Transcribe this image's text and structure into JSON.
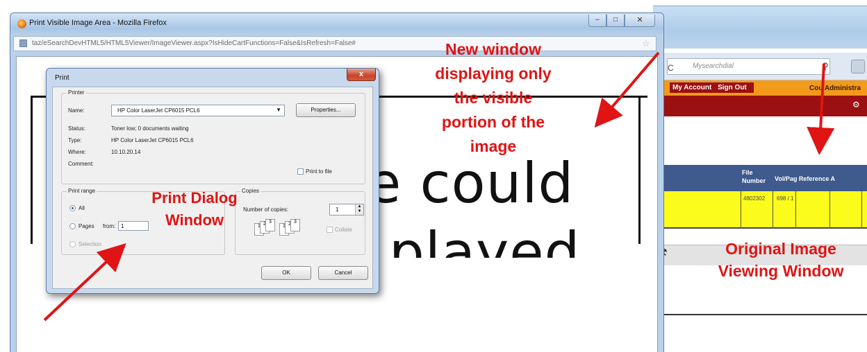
{
  "colors": {
    "annotation_red": "#e01414",
    "highlight_yellow": "#fcfc1c",
    "brand_dark_red": "#9b1010",
    "brand_orange": "#f39a1b",
    "table_header_blue": "#3f5a8c"
  },
  "firefox_window": {
    "title": "Print Visible Image Area - Mozilla Firefox",
    "url": "taz/eSearchDevHTML5/HTML5Viewer/ImageViewer.aspx?IsHideCartFunctions=False&IsRefresh=False#",
    "icons": [
      "firefox-logo-icon",
      "minimize-icon",
      "maximize-icon",
      "close-icon",
      "star-icon"
    ],
    "visible_image_text": [
      "e could",
      "played"
    ]
  },
  "print_dialog": {
    "title": "Print",
    "close_label": "x",
    "printer_group_label": "Printer",
    "name_label": "Name:",
    "name_value": "HP Color LaserJet CP6015 PCL6",
    "properties_button": "Properties...",
    "status_label": "Status:",
    "status_value": "Toner low; 0 documents waiting",
    "type_label": "Type:",
    "type_value": "HP Color LaserJet CP6015 PCL6",
    "where_label": "Where:",
    "where_value": "10.10.20.14",
    "comment_label": "Comment:",
    "print_to_file_label": "Print to file",
    "print_range_label": "Print range",
    "all_label": "All",
    "pages_label": "Pages",
    "from_label": "from:",
    "from_value": "1",
    "selection_label": "Selection",
    "copies_label": "Copies",
    "number_of_copies_label": "Number of copies:",
    "number_of_copies_value": "1",
    "collate_label": "Collate",
    "ok_button": "OK",
    "cancel_button": "Cancel"
  },
  "background_window": {
    "search_placeholder": "Mysearchdial",
    "menu": [
      "My Account",
      "Sign Out"
    ],
    "court_label": "Cou Administra",
    "table_headers": [
      "File Number",
      "Vol/Pag Reference A"
    ],
    "table_row": [
      "4802302",
      "698 / 1"
    ]
  },
  "annotations": {
    "new_window_lines": [
      "New window",
      "displaying only",
      "the visible",
      "portion of the",
      "image"
    ],
    "print_dialog_lines": [
      "Print Dialog",
      "Window"
    ],
    "original_window_lines": [
      "Original Image",
      "Viewing Window"
    ]
  }
}
